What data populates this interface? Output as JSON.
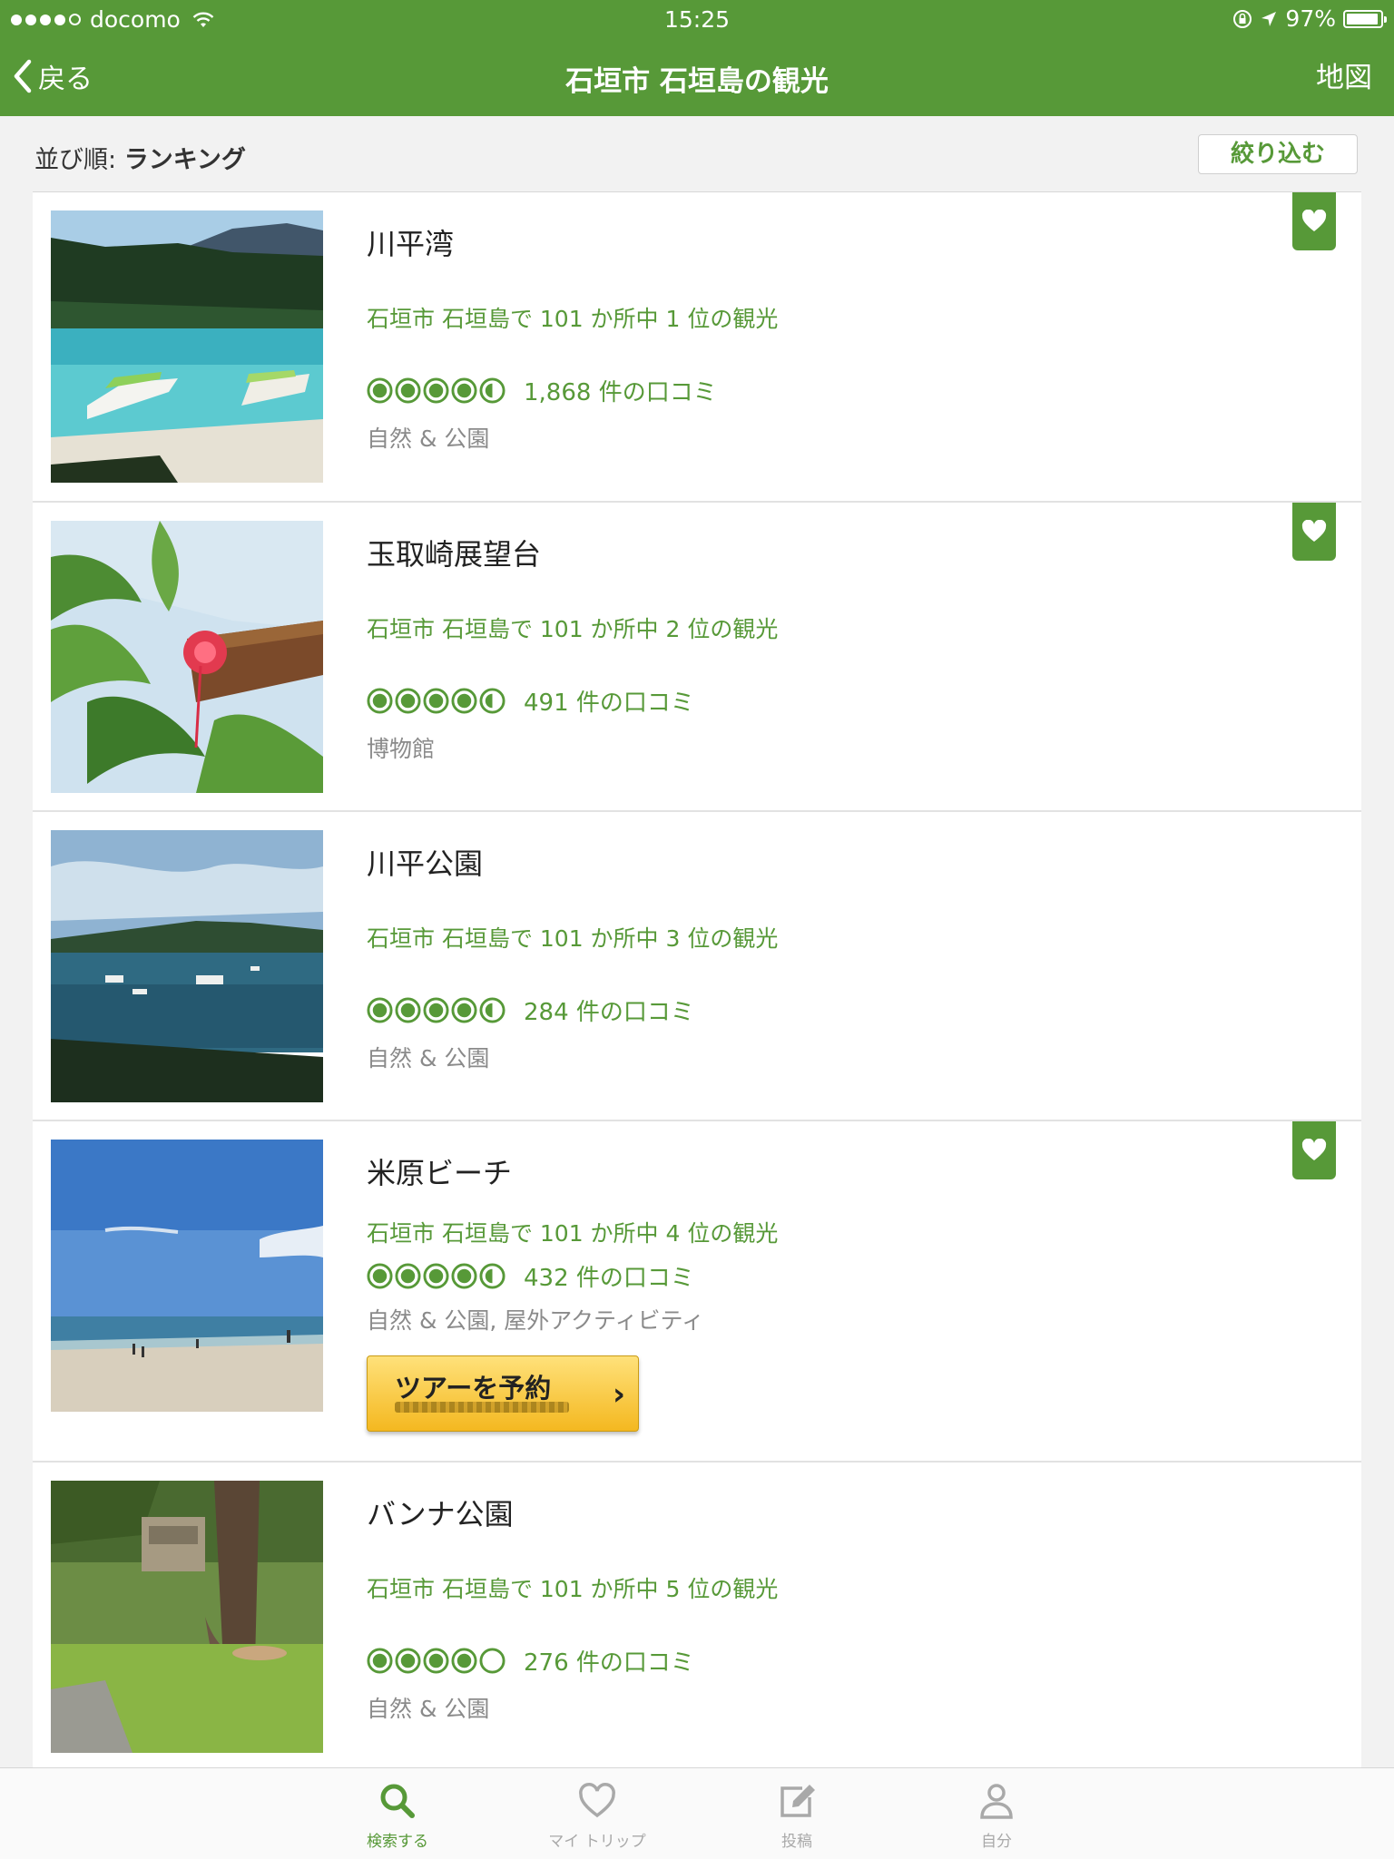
{
  "status_bar": {
    "carrier": "docomo",
    "time": "15:25",
    "battery": "97%"
  },
  "nav": {
    "back_label": "戻る",
    "title": "石垣市 石垣島の観光",
    "map_label": "地図"
  },
  "sort": {
    "prefix": "並び順:",
    "value": "ランキング",
    "filter_label": "絞り込む"
  },
  "colors": {
    "brand_green": "#579938",
    "tour_button": "#f4b820"
  },
  "listings": [
    {
      "name": "川平湾",
      "rank_text": "石垣市 石垣島で 101 か所中 1 位の観光",
      "rating": 4.5,
      "reviews": "1,868 件の口コミ",
      "category": "自然 & 公園",
      "saved": true
    },
    {
      "name": "玉取崎展望台",
      "rank_text": "石垣市 石垣島で 101 か所中 2 位の観光",
      "rating": 4.5,
      "reviews": "491 件の口コミ",
      "category": "博物館",
      "saved": true
    },
    {
      "name": "川平公園",
      "rank_text": "石垣市 石垣島で 101 か所中 3 位の観光",
      "rating": 4.5,
      "reviews": "284 件の口コミ",
      "category": "自然 & 公園",
      "saved": false
    },
    {
      "name": "米原ビーチ",
      "rank_text": "石垣市 石垣島で 101 か所中 4 位の観光",
      "rating": 4.5,
      "reviews": "432 件の口コミ",
      "category": "自然 & 公園, 屋外アクティビティ",
      "saved": true,
      "tour_label": "ツアーを予約"
    },
    {
      "name": "バンナ公園",
      "rank_text": "石垣市 石垣島で 101 か所中 5 位の観光",
      "rating": 4.0,
      "reviews": "276 件の口コミ",
      "category": "自然 & 公園",
      "saved": false
    }
  ],
  "tabs": [
    {
      "label": "検索する",
      "icon": "search-icon",
      "active": true
    },
    {
      "label": "マイ トリップ",
      "icon": "heart-icon",
      "active": false
    },
    {
      "label": "投稿",
      "icon": "edit-icon",
      "active": false
    },
    {
      "label": "自分",
      "icon": "person-icon",
      "active": false
    }
  ]
}
